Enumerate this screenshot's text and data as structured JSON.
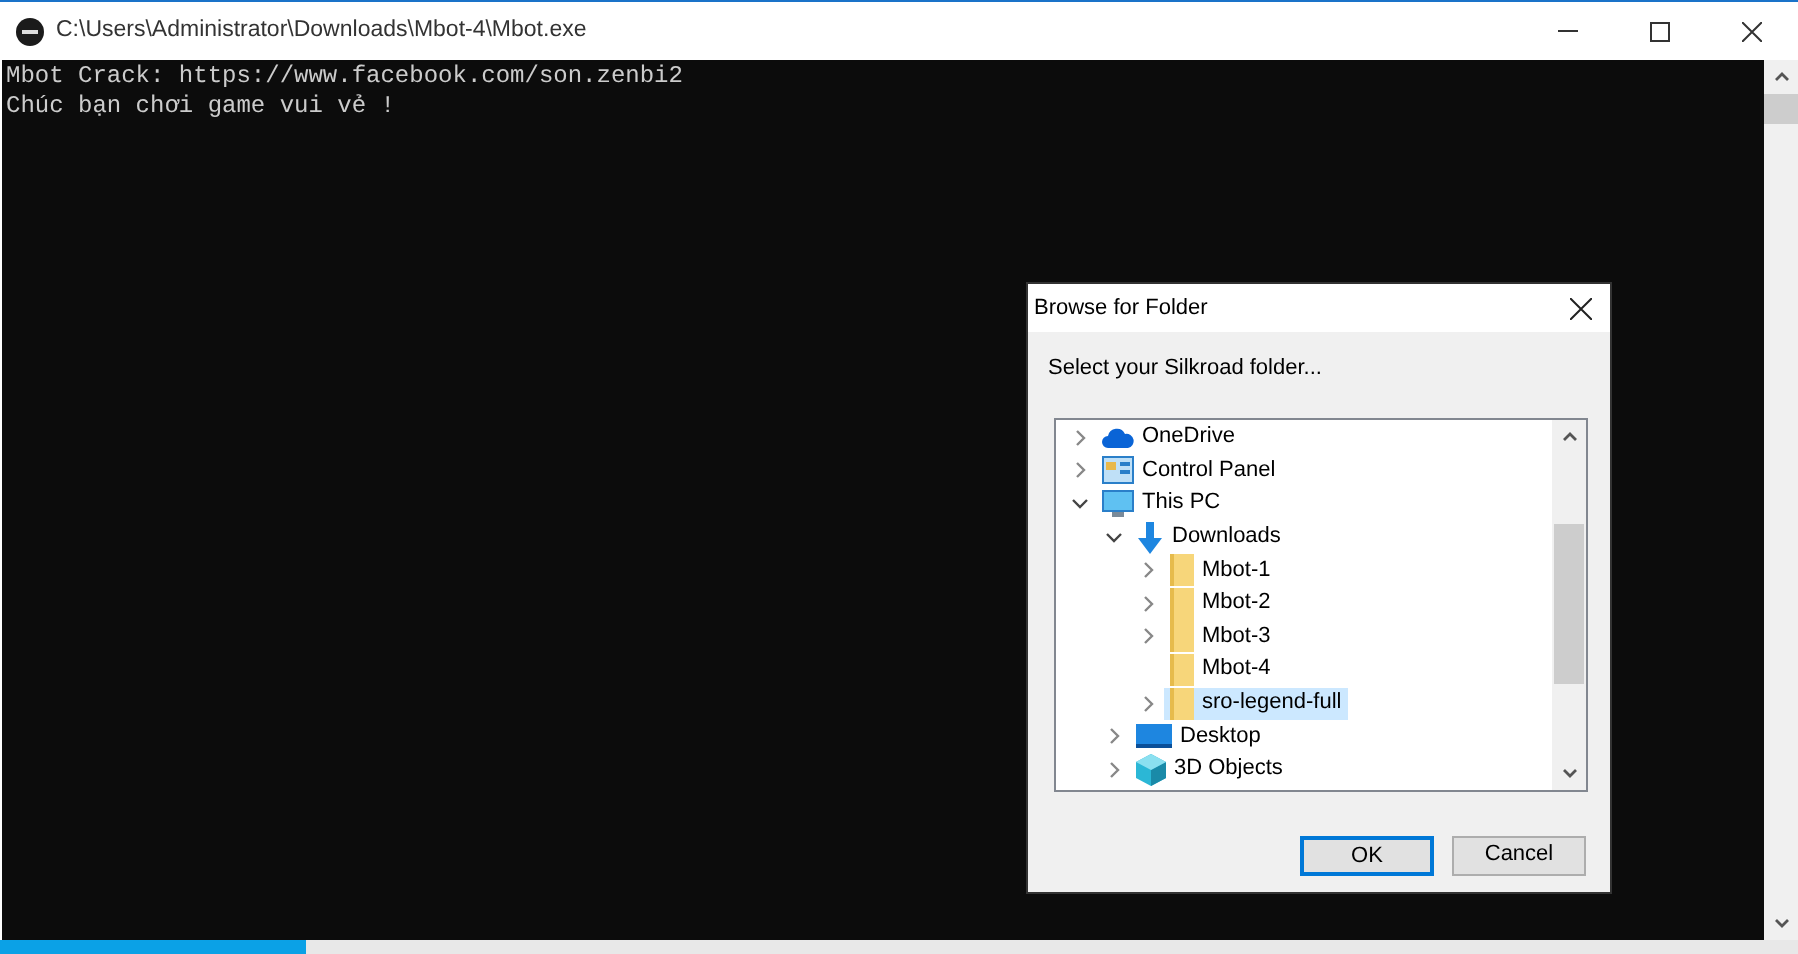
{
  "window": {
    "title": "C:\\Users\\Administrator\\Downloads\\Mbot-4\\Mbot.exe"
  },
  "console": {
    "lines": [
      "Mbot Crack: https://www.facebook.com/son.zenbi2",
      "Chúc bạn chơi game vui vẻ !"
    ]
  },
  "dialog": {
    "title": "Browse for Folder",
    "prompt": "Select your Silkroad folder...",
    "tree": [
      {
        "label": "OneDrive",
        "kind": "cloud",
        "expanded": false,
        "selected": false
      },
      {
        "label": "Control Panel",
        "kind": "control-panel",
        "expanded": false,
        "selected": false
      },
      {
        "label": "This PC",
        "kind": "computer",
        "expanded": true,
        "selected": false,
        "children": [
          {
            "label": "Downloads",
            "kind": "downloads",
            "expanded": true,
            "selected": false,
            "children": [
              {
                "label": "Mbot-1",
                "kind": "folder",
                "expanded": false,
                "selected": false
              },
              {
                "label": "Mbot-2",
                "kind": "folder",
                "expanded": false,
                "selected": false
              },
              {
                "label": "Mbot-3",
                "kind": "folder",
                "expanded": false,
                "selected": false
              },
              {
                "label": "Mbot-4",
                "kind": "folder-leaf",
                "selected": false
              },
              {
                "label": "sro-legend-full",
                "kind": "folder",
                "expanded": false,
                "selected": true
              }
            ]
          },
          {
            "label": "Desktop",
            "kind": "desktop",
            "expanded": false,
            "selected": false
          },
          {
            "label": "3D Objects",
            "kind": "objects",
            "expanded": false,
            "selected": false
          }
        ]
      }
    ],
    "buttons": [
      {
        "label": "OK",
        "default": true
      },
      {
        "label": "Cancel",
        "default": false
      }
    ]
  }
}
